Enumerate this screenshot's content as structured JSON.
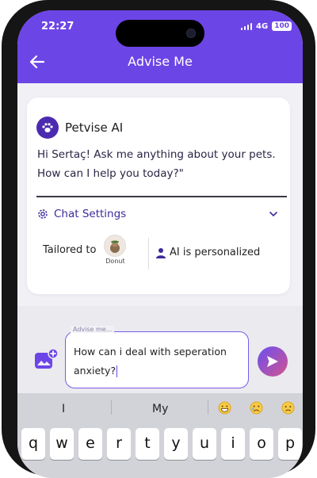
{
  "status_bar": {
    "time": "22:27",
    "network": "4G",
    "battery": "100"
  },
  "header": {
    "title": "Advise Me"
  },
  "assistant": {
    "name": "Petvise AI",
    "greeting": "Hi Sertaç! Ask me anything about your pets. How can I help you today?\""
  },
  "chat_settings": {
    "label": "Chat Settings",
    "tailored_label": "Tailored to",
    "pet_name": "Donut",
    "personalized_label": "AI is personalized"
  },
  "input": {
    "label": "Advise me...",
    "value": "How can i deal with seperation anxiety?"
  },
  "keyboard": {
    "suggestions": [
      "I",
      "My"
    ],
    "emoji_suggestions": [
      "grinning-face",
      "crying-face",
      "worried-face"
    ],
    "top_row": [
      "q",
      "w",
      "e",
      "r",
      "t",
      "y",
      "u",
      "i",
      "o",
      "p"
    ]
  },
  "colors": {
    "accent": "#6c45e6",
    "brand_dark": "#3d2a9a",
    "send_gradient_end": "#d3548e"
  }
}
